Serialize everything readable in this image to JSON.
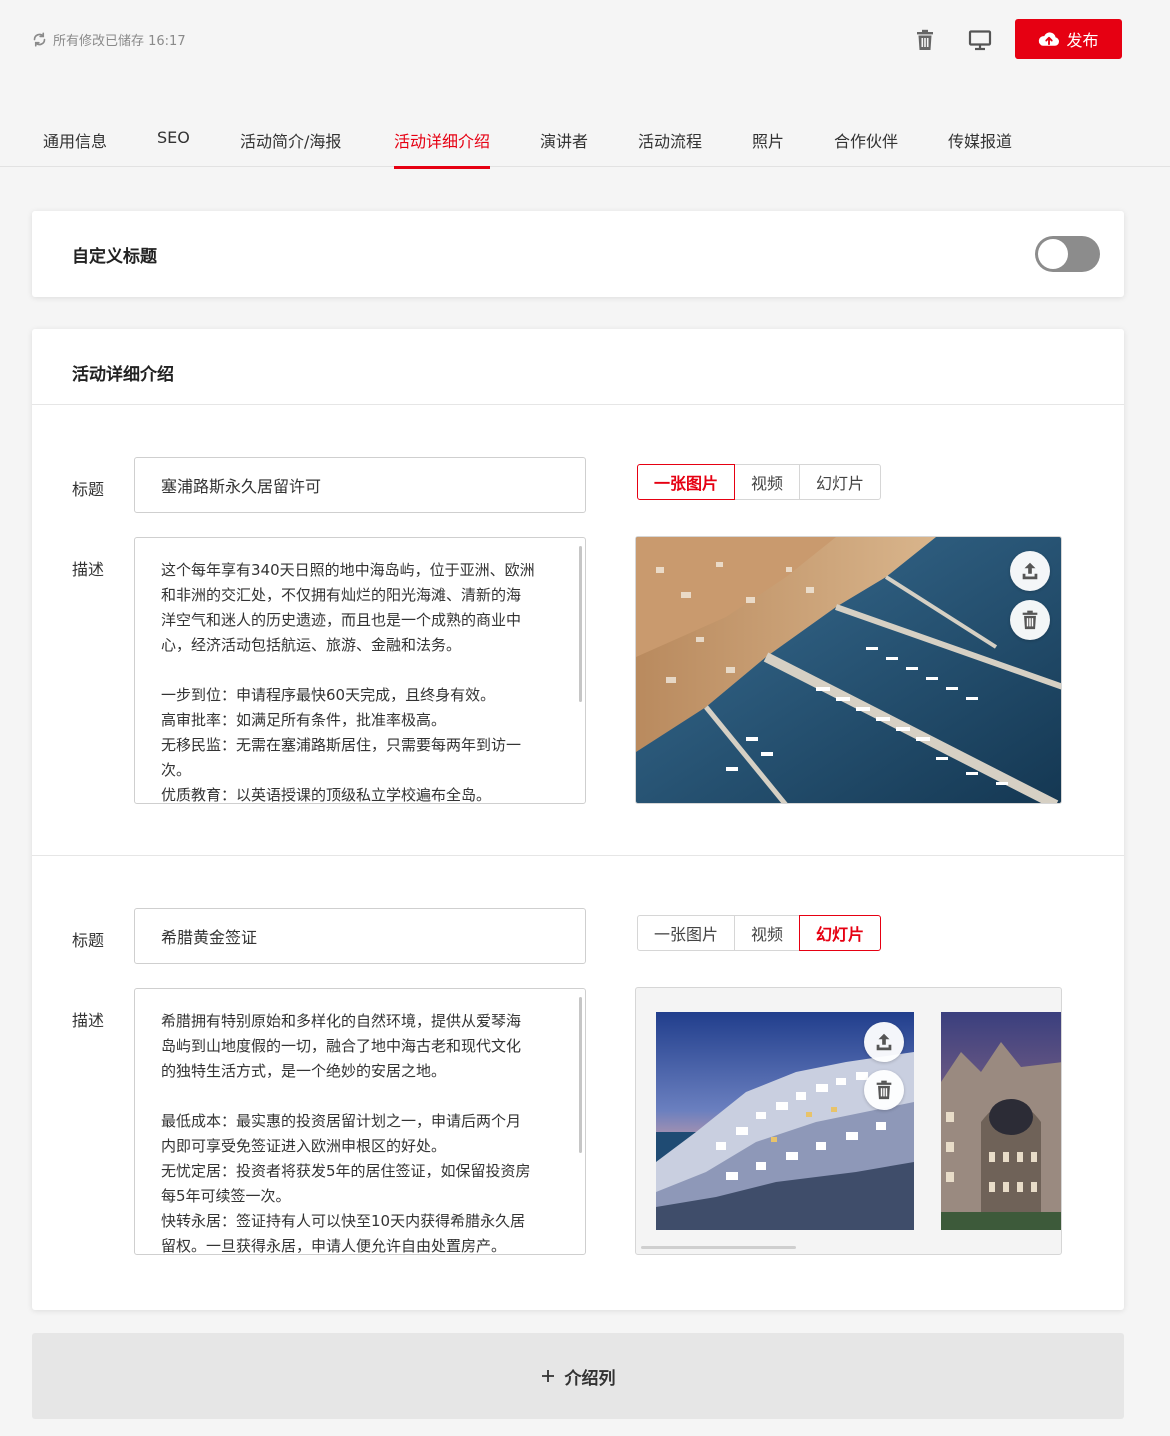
{
  "header": {
    "save_status": "所有修改已储存 16:17",
    "publish_label": "发布"
  },
  "tabs": [
    {
      "label": "通用信息"
    },
    {
      "label": "SEO"
    },
    {
      "label": "活动简介/海报"
    },
    {
      "label": "活动详细介绍",
      "active": true
    },
    {
      "label": "演讲者"
    },
    {
      "label": "活动流程"
    },
    {
      "label": "照片"
    },
    {
      "label": "合作伙伴"
    },
    {
      "label": "传媒报道"
    }
  ],
  "custom_title": {
    "label": "自定义标题",
    "enabled": false
  },
  "details": {
    "section_title": "活动详细介绍",
    "title_label": "标题",
    "desc_label": "描述",
    "media_tabs": [
      "一张图片",
      "视频",
      "幻灯片"
    ],
    "items": [
      {
        "title": "塞浦路斯永久居留许可",
        "active_media": "一张图片",
        "description_lines": [
          "这个每年享有340天日照的地中海岛屿，位于亚洲、欧洲",
          "和非洲的交汇处，不仅拥有灿烂的阳光海滩、清新的海",
          "洋空气和迷人的历史遗迹，而且也是一个成熟的商业中",
          "心，经济活动包括航运、旅游、金融和法务。",
          "",
          "一步到位：申请程序最快60天完成，且终身有效。",
          "高审批率：如满足所有条件，批准率极高。",
          "无移民监：无需在塞浦路斯居住，只需要每两年到访一",
          "次。",
          "优质教育：以英语授课的顶级私立学校遍布全岛。"
        ]
      },
      {
        "title": "希腊黄金签证",
        "active_media": "幻灯片",
        "description_lines": [
          "希腊拥有特别原始和多样化的自然环境，提供从爱琴海",
          "岛屿到山地度假的一切，融合了地中海古老和现代文化",
          "的独特生活方式，是一个绝妙的安居之地。",
          "",
          "最低成本：最实惠的投资居留计划之一，申请后两个月",
          "内即可享受免签证进入欧洲申根区的好处。",
          "无忧定居：投资者将获发5年的居住签证，如保留投资房",
          "每5年可续签一次。",
          "快转永居：签证持有人可以快至10天内获得希腊永久居",
          "留权。一旦获得永居，申请人便允许自由处置房产。"
        ]
      }
    ]
  },
  "add_button": {
    "icon": "plus-icon",
    "label": "介绍列"
  },
  "colors": {
    "accent": "#e60012"
  }
}
